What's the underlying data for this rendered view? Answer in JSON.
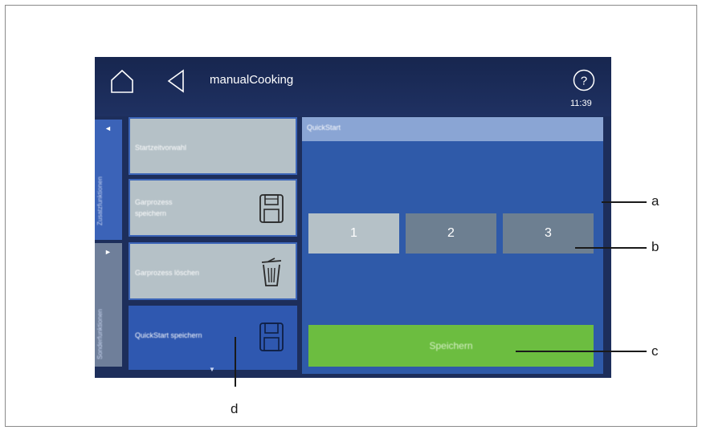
{
  "screen": {
    "title": "manualCooking",
    "clock": "11:39"
  },
  "side_tabs": [
    {
      "label": "Zusatzfunktionen",
      "arrow": "◄"
    },
    {
      "label": "Sonderfunktionen",
      "arrow": "►"
    }
  ],
  "function_buttons": [
    {
      "label": "Startzeitvorwahl",
      "icon": ""
    },
    {
      "label_line1": "Garprozess",
      "label_line2": "speichern",
      "icon": "save-icon"
    },
    {
      "label": "Garprozess löschen",
      "icon": "trash-icon"
    },
    {
      "label": "QuickStart speichern",
      "icon": "save-icon"
    }
  ],
  "quickstart_panel": {
    "title": "QuickStart",
    "slots": [
      "1",
      "2",
      "3"
    ],
    "save_label": "Speichern"
  },
  "callouts": [
    "a",
    "b",
    "c",
    "d"
  ],
  "colors": {
    "screen_bg": "#1d2e5b",
    "panel_bg": "#2f5aa9",
    "selected_slot": "#b5c1c7",
    "slot": "#6d7f91",
    "save_button": "#6cbd40"
  }
}
